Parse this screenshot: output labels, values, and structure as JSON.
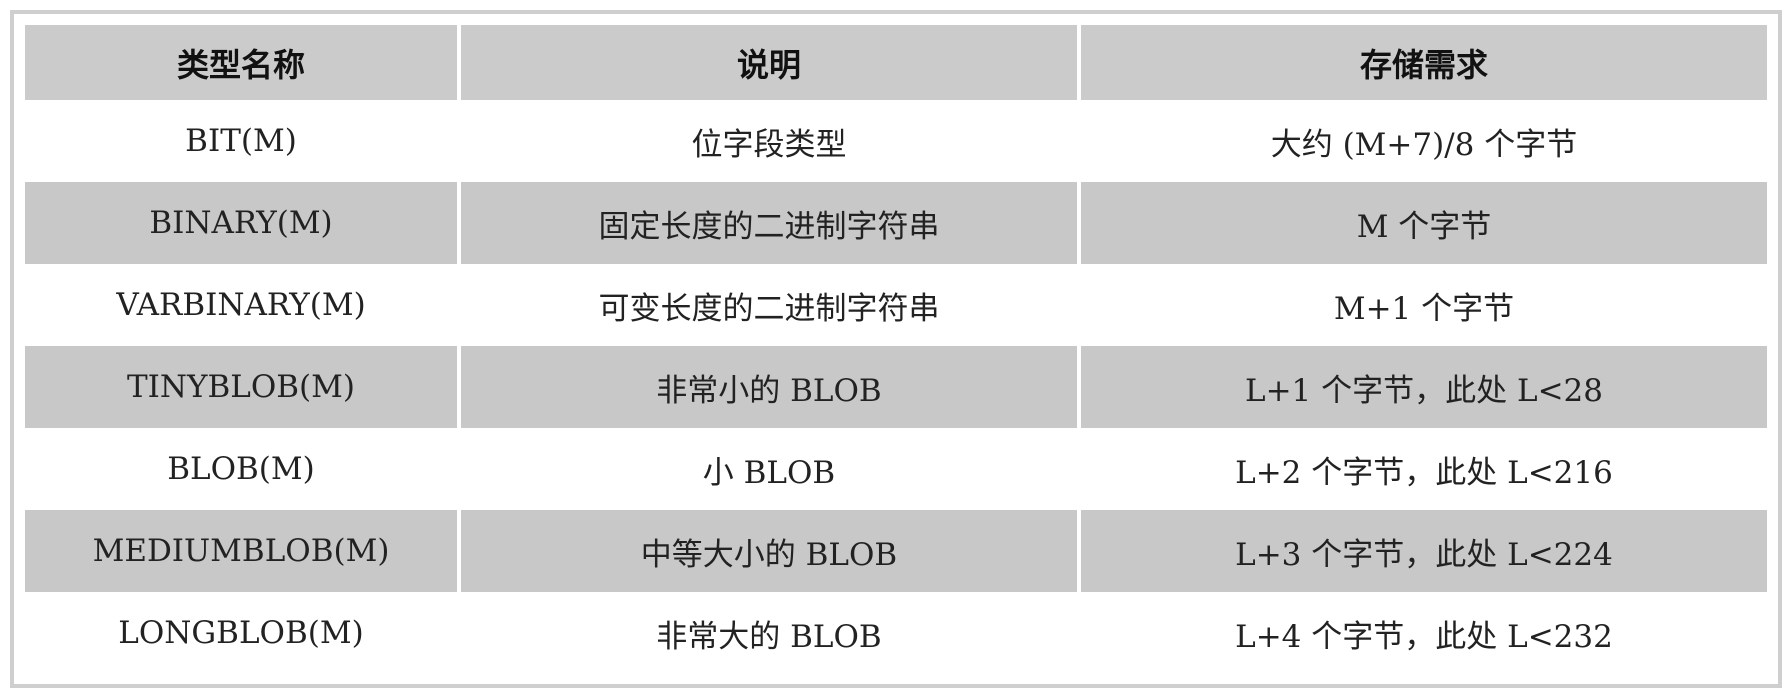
{
  "headers": [
    "类型名称",
    "说明",
    "存储需求"
  ],
  "rows": [
    [
      "BIT(M)",
      "位字段类型",
      "大约 (M+7)/8 个字节"
    ],
    [
      "BINARY(M)",
      "固定长度的二进制字符串",
      "M 个字节"
    ],
    [
      "VARBINARY(M)",
      "可变长度的二进制字符串",
      "M+1 个字节"
    ],
    [
      "TINYBLOB(M)",
      "非常小的 BLOB",
      "L+1 个字节，此处 L<28"
    ],
    [
      "BLOB(M)",
      "小 BLOB",
      "L+2 个字节，此处 L<216"
    ],
    [
      "MEDIUMBLOB(M)",
      "中等大小的 BLOB",
      "L+3 个字节，此处 L<224"
    ],
    [
      "LONGBLOB(M)",
      "非常大的 BLOB",
      "L+4 个字节，此处 L<232"
    ]
  ]
}
